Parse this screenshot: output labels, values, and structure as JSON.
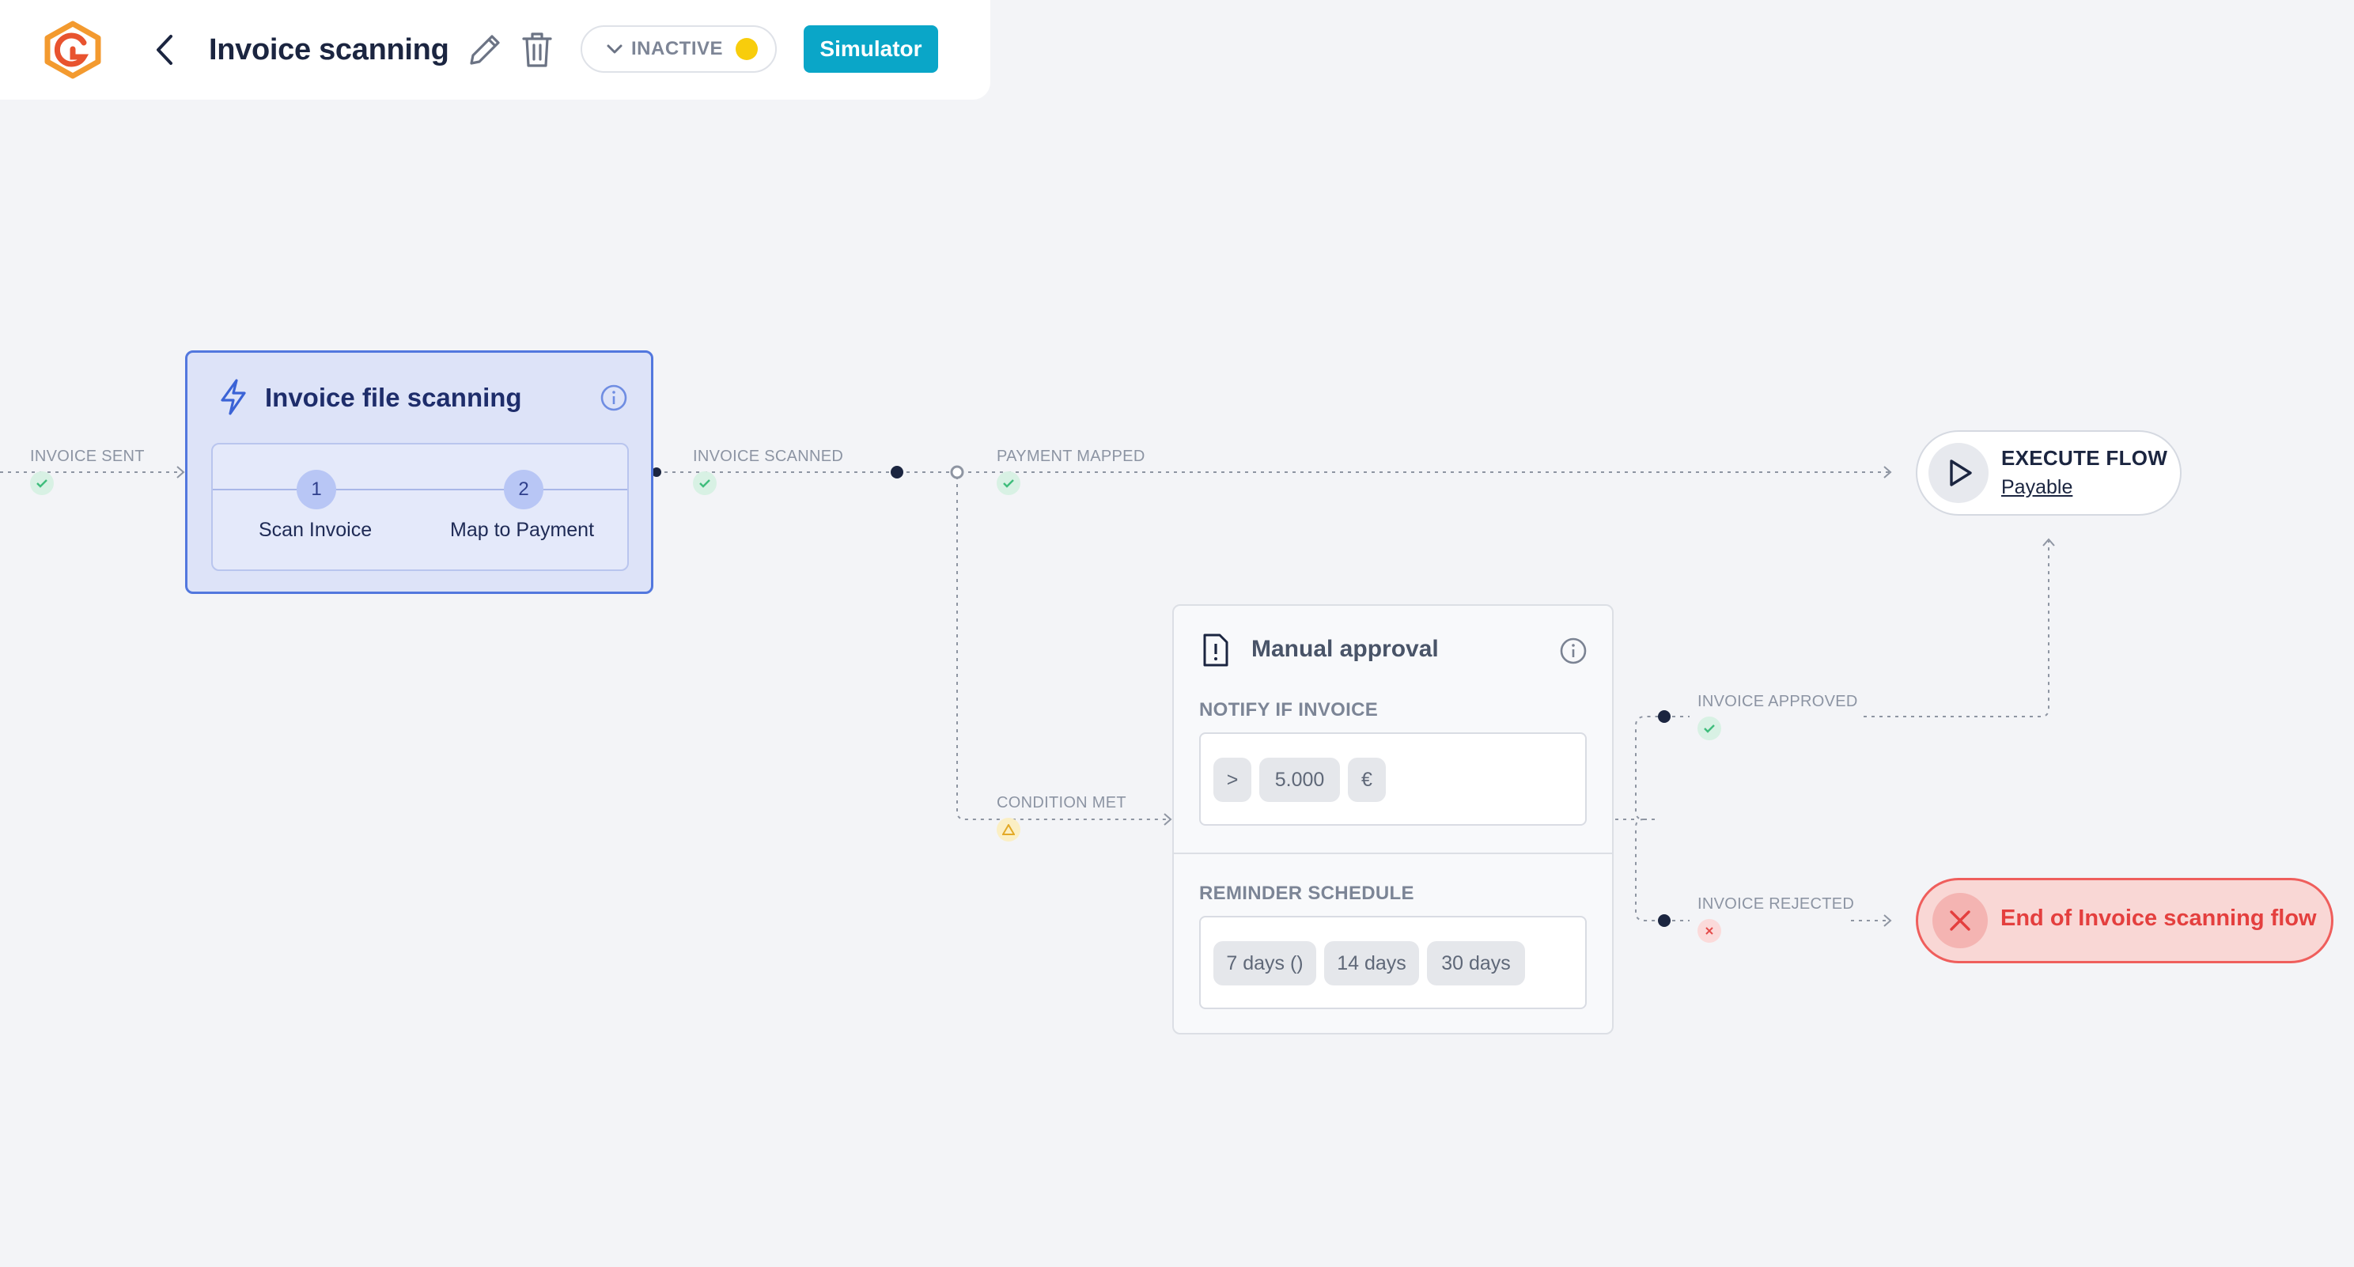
{
  "header": {
    "logo_icon": "brand-logo-icon",
    "back_icon": "chevron-left-icon",
    "title": "Invoice scanning",
    "edit_icon": "pencil-icon",
    "delete_icon": "trash-icon",
    "status": {
      "label": "INACTIVE",
      "dot_color": "#f8cd0c"
    },
    "simulator_label": "Simulator"
  },
  "edges": {
    "invoice_sent": "INVOICE SENT",
    "invoice_scanned": "INVOICE SCANNED",
    "payment_mapped": "PAYMENT MAPPED",
    "condition_met": "CONDITION MET",
    "invoice_approved": "INVOICE APPROVED",
    "invoice_rejected": "INVOICE REJECTED"
  },
  "trigger": {
    "title": "Invoice file scanning",
    "icon": "lightning-bolt-icon",
    "steps": [
      {
        "number": "1",
        "label": "Scan Invoice"
      },
      {
        "number": "2",
        "label": "Map to Payment"
      }
    ]
  },
  "execute_flow": {
    "label": "EXECUTE FLOW",
    "link": "Payable"
  },
  "end_flow": {
    "label": "End of Invoice scanning flow"
  },
  "approval": {
    "title": "Manual approval",
    "notify_label": "NOTIFY IF INVOICE",
    "condition": {
      "operator": ">",
      "amount": "5.000",
      "currency": "€"
    },
    "reminder_label": "REMINDER SCHEDULE",
    "reminders": [
      "7 days ()",
      "14 days",
      "30 days"
    ]
  },
  "colors": {
    "accent": "#0aa6c8",
    "trigger_border": "#5277de",
    "end_border": "#ef5e5c",
    "status_inactive": "#f8cd0c"
  }
}
